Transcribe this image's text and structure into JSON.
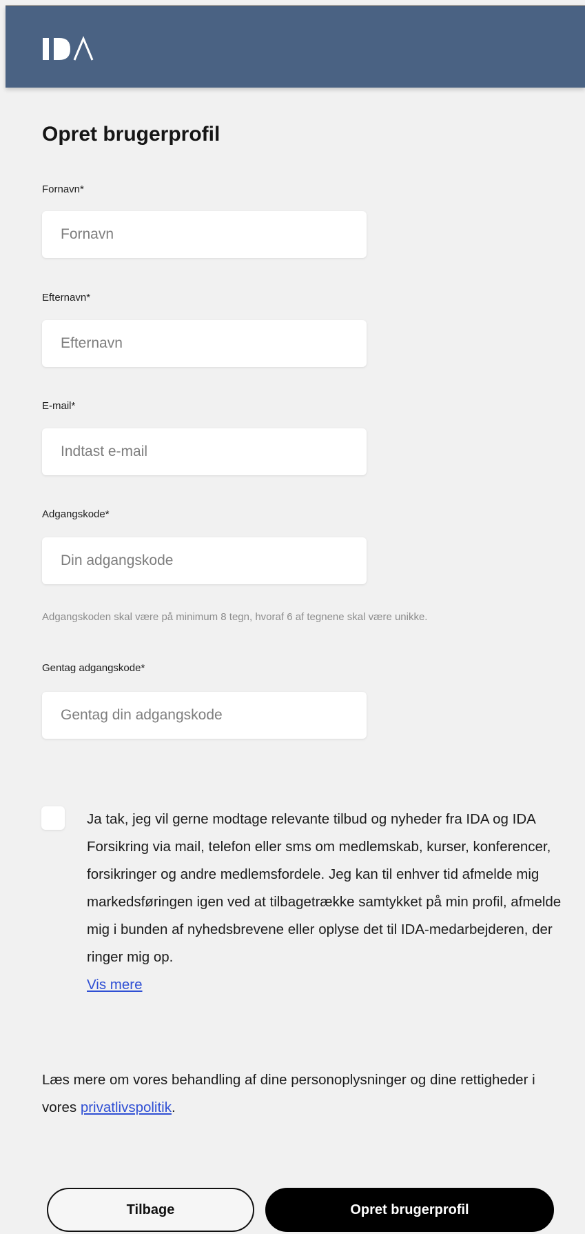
{
  "header": {
    "logo_text": "IDA",
    "logo_icon": "ida-logo"
  },
  "form": {
    "title": "Opret brugerprofil",
    "fields": [
      {
        "label": "Fornavn*",
        "placeholder": "Fornavn",
        "value": ""
      },
      {
        "label": "Efternavn*",
        "placeholder": "Efternavn",
        "value": ""
      },
      {
        "label": "E-mail*",
        "placeholder": "Indtast e-mail",
        "value": ""
      },
      {
        "label": "Adgangskode*",
        "placeholder": "Din adgangskode",
        "value": ""
      },
      {
        "label": "Gentag adgangskode*",
        "placeholder": "Gentag din adgangskode",
        "value": ""
      }
    ],
    "password_hint": "Adgangskoden skal være på minimum 8 tegn, hvoraf 6 af tegnene skal være unikke.",
    "consent": {
      "checked": false,
      "text": "Ja tak, jeg vil gerne modtage relevante tilbud og nyheder fra IDA og IDA Forsikring via mail, telefon eller sms om medlemskab, kurser, konferencer, forsikringer og andre medlemsfordele. Jeg kan til enhver tid afmelde mig markedsføringen igen ved at tilbagetrække samtykket på min profil, afmelde mig i bunden af nyhedsbrevene eller oplyse det til IDA-medarbejderen, der ringer mig op.",
      "more_link": "Vis mere"
    },
    "privacy": {
      "text_before": "Læs mere om vores behandling af dine personoplysninger og dine rettigheder i vores ",
      "link": "privatlivspolitik",
      "text_after": "."
    },
    "buttons": {
      "back": "Tilbage",
      "create": "Opret brugerprofil"
    }
  },
  "colors": {
    "header_bg": "#4a6283",
    "page_bg": "#f1f1f1",
    "link": "#2f4fd4",
    "primary_button": "#000000"
  }
}
